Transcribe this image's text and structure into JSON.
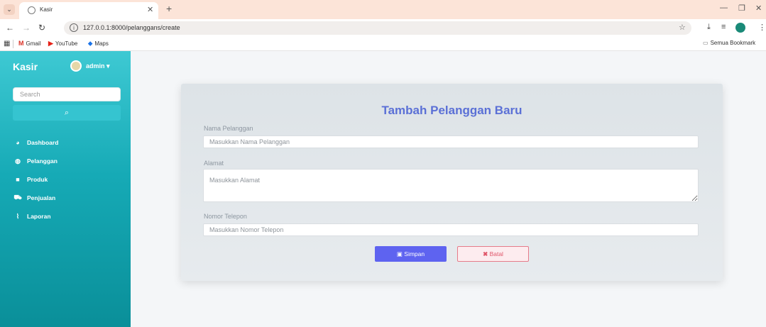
{
  "browser": {
    "tab_title": "Kasir",
    "url": "127.0.0.1:8000/pelanggans/create",
    "bookmarks": [
      "Gmail",
      "YouTube",
      "Maps"
    ],
    "bookmarks_folder": "Semua Bookmark"
  },
  "sidebar": {
    "brand": "Kasir",
    "user": "admin",
    "search_placeholder": "Search",
    "items": [
      {
        "label": "Dashboard",
        "icon": "dashboard-icon"
      },
      {
        "label": "Pelanggan",
        "icon": "users-icon"
      },
      {
        "label": "Produk",
        "icon": "product-icon"
      },
      {
        "label": "Penjualan",
        "icon": "cart-icon"
      },
      {
        "label": "Laporan",
        "icon": "chart-icon"
      }
    ]
  },
  "form": {
    "title": "Tambah Pelanggan Baru",
    "name_label": "Nama Pelanggan",
    "name_placeholder": "Masukkan Nama Pelanggan",
    "address_label": "Alamat",
    "address_placeholder": "Masukkan Alamat",
    "phone_label": "Nomor Telepon",
    "phone_placeholder": "Masukkan Nomor Telepon",
    "save_label": "Simpan",
    "cancel_label": "Batal"
  },
  "colors": {
    "sidebar_accent": "#16aab6",
    "title_color": "#5b70d6",
    "save_button": "#5e63f0",
    "cancel_text": "#e0566a"
  }
}
